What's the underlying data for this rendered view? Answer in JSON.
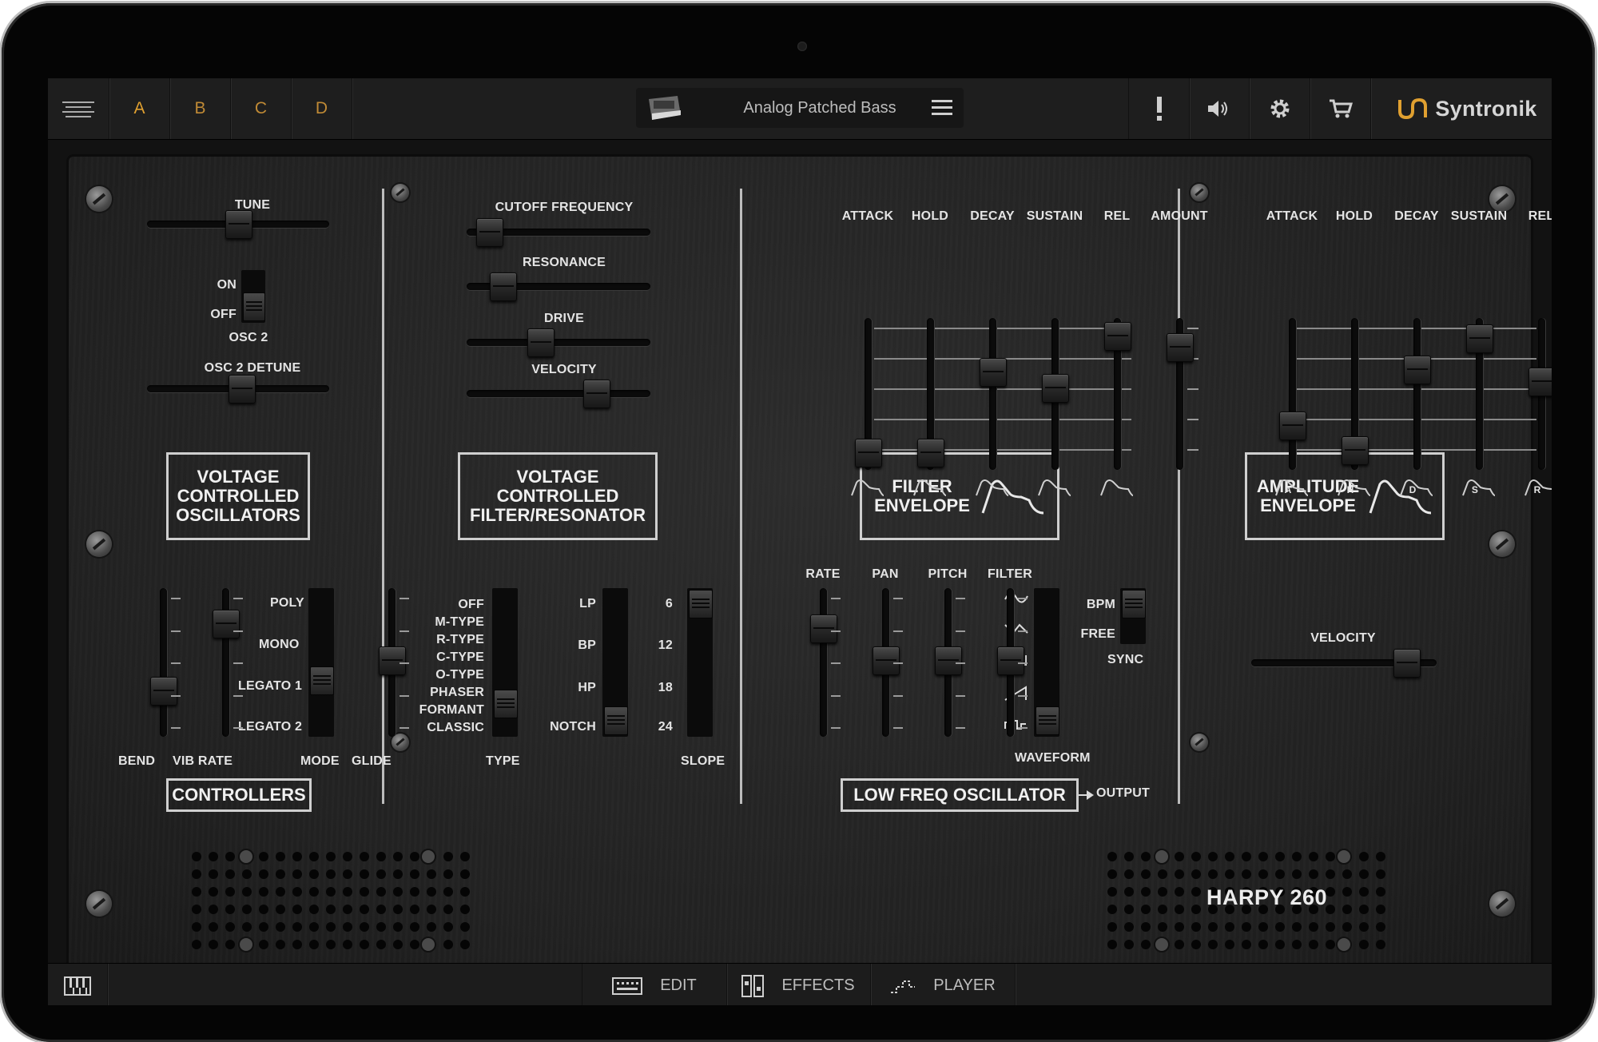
{
  "topbar": {
    "menu_icon": "hamburger-icon",
    "parts": [
      "A",
      "B",
      "C",
      "D"
    ],
    "active_part": "A",
    "preset_name": "Analog Patched Bass",
    "icons": [
      "alert-icon",
      "speaker-icon",
      "gear-icon",
      "cart-icon"
    ],
    "brand": "Syntronik"
  },
  "vco": {
    "tune": "TUNE",
    "on": "ON",
    "off": "OFF",
    "osc2": "OSC 2",
    "detune": "OSC 2 DETUNE",
    "title": [
      "VOLTAGE",
      "CONTROLLED",
      "OSCILLATORS"
    ]
  },
  "vcf": {
    "cutoff": "CUTOFF FREQUENCY",
    "resonance": "RESONANCE",
    "drive": "DRIVE",
    "velocity": "VELOCITY",
    "title": [
      "VOLTAGE",
      "CONTROLLED",
      "FILTER/RESONATOR"
    ]
  },
  "filter_env": {
    "labels": [
      "ATTACK",
      "HOLD",
      "DECAY",
      "SUSTAIN",
      "REL",
      "AMOUNT"
    ],
    "title": [
      "FILTER",
      "ENVELOPE"
    ]
  },
  "amp_env": {
    "labels": [
      "ATTACK",
      "HOLD",
      "DECAY",
      "SUSTAIN",
      "REL"
    ],
    "shape_letters": [
      "A",
      "H",
      "D",
      "S",
      "R"
    ],
    "title": [
      "AMPLITUDE",
      "ENVELOPE"
    ],
    "velocity": "VELOCITY"
  },
  "controllers": {
    "labels": [
      "BEND",
      "VIB RATE",
      "MODE",
      "GLIDE"
    ],
    "modes": [
      "POLY",
      "MONO",
      "LEGATO 1",
      "LEGATO 2"
    ],
    "title": "CONTROLLERS"
  },
  "filter_type": {
    "types": [
      "OFF",
      "M-TYPE",
      "R-TYPE",
      "C-TYPE",
      "O-TYPE",
      "PHASER",
      "FORMANT",
      "CLASSIC"
    ],
    "type_label": "TYPE",
    "modes": [
      "LP",
      "BP",
      "HP",
      "NOTCH"
    ],
    "slopes": [
      "6",
      "12",
      "18",
      "24"
    ],
    "slope_label": "SLOPE"
  },
  "lfo": {
    "labels": [
      "RATE",
      "PAN",
      "PITCH",
      "FILTER"
    ],
    "waveform": "WAVEFORM",
    "sync_opts": [
      "BPM",
      "FREE"
    ],
    "sync": "SYNC",
    "title": "LOW FREQ OSCILLATOR",
    "output": "OUTPUT"
  },
  "model": "HARPY 260",
  "bottombar": {
    "keyboard_icon": "keyboard-icon",
    "edit": "EDIT",
    "effects": "EFFECTS",
    "player": "PLAYER"
  },
  "slider_values": {
    "tune": 0.5,
    "osc2_detune": 0.52,
    "cutoff": 0.05,
    "resonance": 0.14,
    "drive": 0.38,
    "velocity": 0.74,
    "filter_env": [
      0.03,
      0.03,
      0.68,
      0.55,
      0.97,
      0.88
    ],
    "amp_env": [
      0.25,
      0.05,
      0.7,
      0.95,
      0.6
    ],
    "bend": 0.27,
    "vib_rate": 0.82,
    "glide": 0.52,
    "lfo": [
      0.78,
      0.52,
      0.52,
      0.52
    ],
    "amp_velocity": 0.9
  },
  "colors": {
    "accent": "#e0a030",
    "panel": "#262626",
    "label": "#e4e4e4"
  }
}
